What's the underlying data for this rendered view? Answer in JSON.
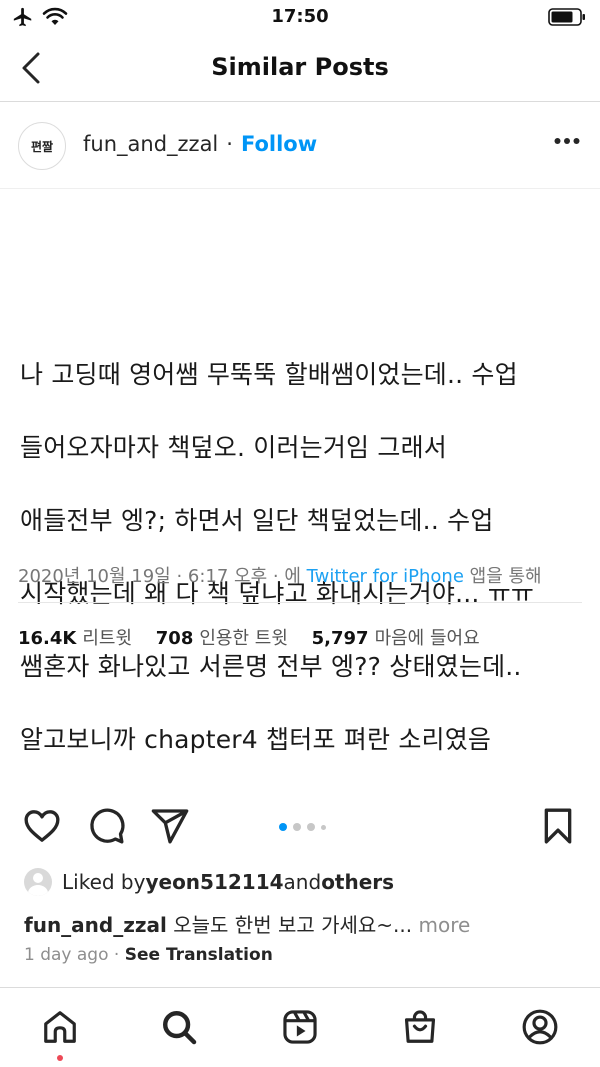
{
  "status_bar": {
    "time": "17:50"
  },
  "nav": {
    "title": "Similar Posts"
  },
  "post": {
    "avatar_text": "편짤",
    "username": "fun_and_zzal",
    "separator": "·",
    "follow_label": "Follow",
    "tweet": {
      "text_lines": [
        "나 고딩때 영어쌤 무뚝뚝 할배쌤이었는데.. 수업",
        "들어오자마자 책덮오. 이러는거임 그래서",
        "애들전부 엥?; 하면서 일단 책덮었는데.. 수업",
        "시작했는데 왜 다 책 덮냐고 화내시는거야... ㅠㅠ",
        "쌤혼자 화나있고 서른명 전부 엥?? 상태였는데..",
        "알고보니까 chapter4 챕터포 펴란 소리였음"
      ],
      "meta_prefix": "2020년 10월 19일 · 6:17 오후 · 에 ",
      "meta_link": "Twitter for iPhone",
      "meta_suffix": " 앱을 통해",
      "stats": [
        {
          "value": "16.4K",
          "label": "리트윗"
        },
        {
          "value": "708",
          "label": "인용한 트윗"
        },
        {
          "value": "5,797",
          "label": "마음에 들어요"
        }
      ]
    },
    "carousel": {
      "count": 4,
      "active": 0
    },
    "likes": {
      "prefix": "Liked by ",
      "user": "yeon512114",
      "middle": " and ",
      "others": "others"
    },
    "caption": {
      "username": "fun_and_zzal",
      "text": " 오늘도 한번 보고 가세요~...",
      "more": " more"
    },
    "time_ago": "1 day ago",
    "time_sep": " · ",
    "see_translation": "See Translation"
  },
  "colors": {
    "accent": "#0095f6",
    "twitter": "#1da1f2",
    "notification": "#ed4956"
  },
  "tabs": [
    "home-icon",
    "search-icon",
    "reels-icon",
    "shop-icon",
    "profile-icon"
  ]
}
